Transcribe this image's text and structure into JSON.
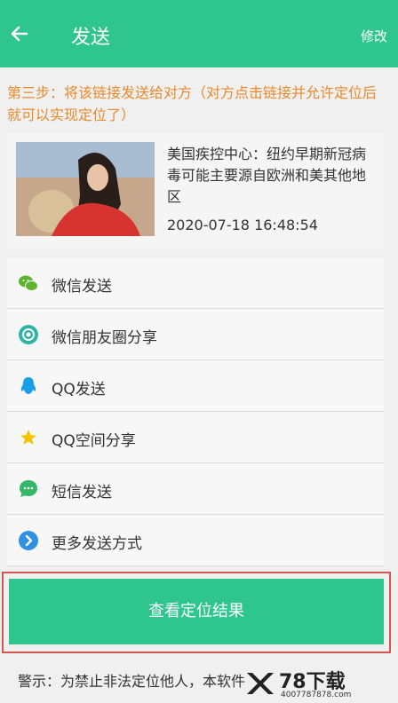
{
  "header": {
    "title": "发送",
    "edit_label": "修改"
  },
  "step_text": "第三步：将该链接发送给对方（对方点击链接并允许定位后就可以实现定位了）",
  "news": {
    "title": "美国疾控中心：纽约早期新冠病毒可能主要源自欧洲和美其他地区",
    "time": "2020-07-18 16:48:54"
  },
  "share_options": [
    {
      "label": "微信发送",
      "icon": "wechat-icon"
    },
    {
      "label": "微信朋友圈分享",
      "icon": "moments-icon"
    },
    {
      "label": "QQ发送",
      "icon": "qq-icon"
    },
    {
      "label": "QQ空间分享",
      "icon": "qzone-icon"
    },
    {
      "label": "短信发送",
      "icon": "sms-icon"
    },
    {
      "label": "更多发送方式",
      "icon": "more-icon"
    }
  ],
  "result_button": "查看定位结果",
  "warning": "警示：为禁止非法定位他人，本软件",
  "watermark": {
    "text": "78下载",
    "url": "4007787878.com"
  },
  "colors": {
    "primary": "#2ec58e",
    "step": "#e8892a",
    "highlight": "#d9534f"
  }
}
